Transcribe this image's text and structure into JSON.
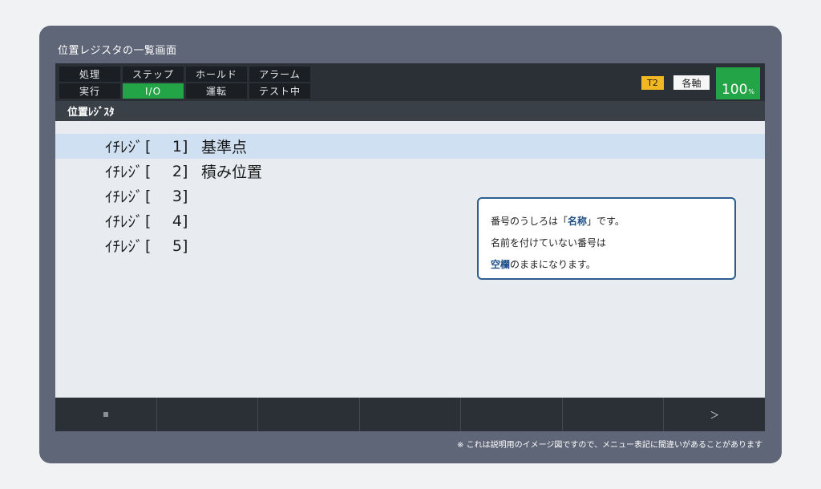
{
  "window": {
    "title": "位置レジスタの一覧画面"
  },
  "tabs": [
    {
      "label": "処理",
      "active": false
    },
    {
      "label": "ステップ",
      "active": false
    },
    {
      "label": "ホールド",
      "active": false
    },
    {
      "label": "アラーム",
      "active": false
    },
    {
      "label": "実行",
      "active": false
    },
    {
      "label": "I/O",
      "active": true
    },
    {
      "label": "運転",
      "active": false
    },
    {
      "label": "テスト中",
      "active": false
    }
  ],
  "status": {
    "tool": "T2",
    "axis": "各軸",
    "speed": "100",
    "speed_unit": "%",
    "tool_color": "#f2b822",
    "speed_color": "#23a446"
  },
  "screen_title": "位置ﾚｼﾞｽﾀ",
  "registers": [
    {
      "prefix": "ｲﾁﾚｼﾞ",
      "open": "[",
      "number": "1",
      "close": "]",
      "name": "基準点",
      "selected": true
    },
    {
      "prefix": "ｲﾁﾚｼﾞ",
      "open": "[",
      "number": "2",
      "close": "]",
      "name": "積み位置",
      "selected": false
    },
    {
      "prefix": "ｲﾁﾚｼﾞ",
      "open": "[",
      "number": "3",
      "close": "]",
      "name": "",
      "selected": false
    },
    {
      "prefix": "ｲﾁﾚｼﾞ",
      "open": "[",
      "number": "4",
      "close": "]",
      "name": "",
      "selected": false
    },
    {
      "prefix": "ｲﾁﾚｼﾞ",
      "open": "[",
      "number": "5",
      "close": "]",
      "name": "",
      "selected": false
    }
  ],
  "callout": {
    "line1_pre": "番号のうしろは「",
    "line1_hl": "名称",
    "line1_post": "」です。",
    "line2": "名前を付けていない番号は",
    "line3_hl": "空欄",
    "line3_post": "のままになります。"
  },
  "function_keys": [
    {
      "label": "",
      "icon": "stop-icon"
    },
    {
      "label": ""
    },
    {
      "label": ""
    },
    {
      "label": ""
    },
    {
      "label": ""
    },
    {
      "label": ""
    },
    {
      "label": "＞",
      "icon": "chevron-right-icon"
    }
  ],
  "footnote": "※ これは説明用のイメージ図ですので、メニュー表記に間違いがあることがあります"
}
